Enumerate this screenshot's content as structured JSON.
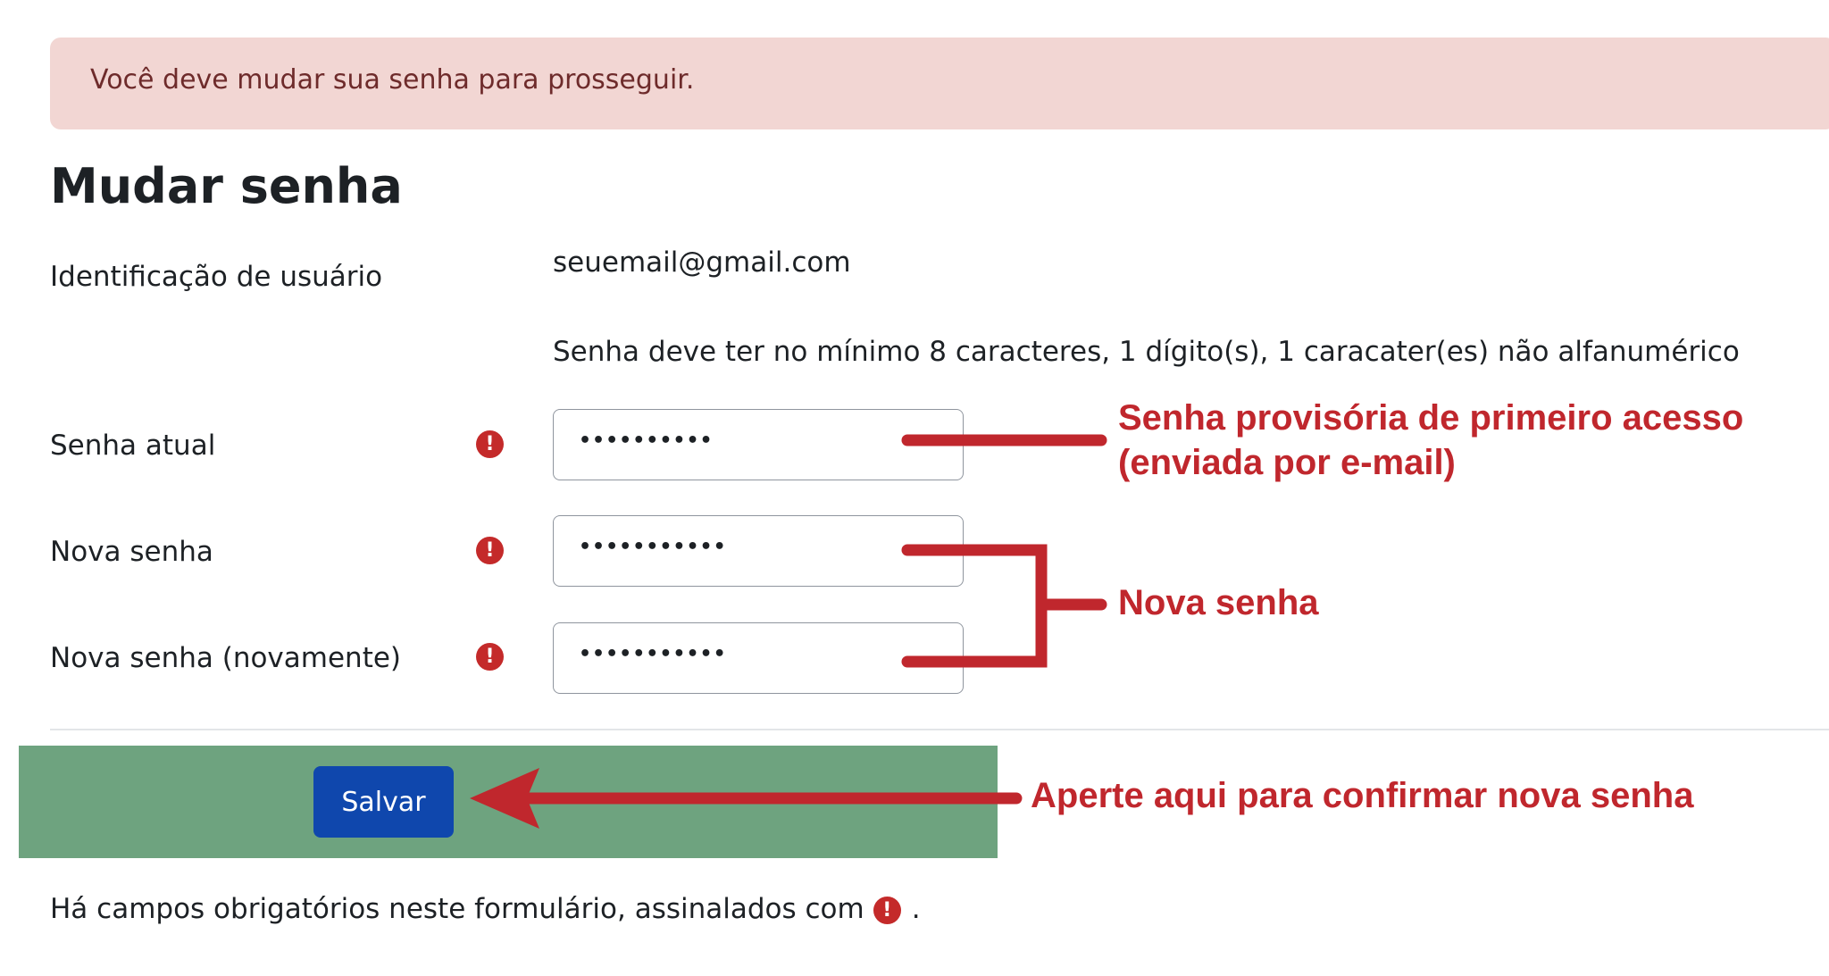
{
  "alert": {
    "text": "Você deve mudar sua senha para prosseguir."
  },
  "page": {
    "title": "Mudar senha"
  },
  "form": {
    "username_label": "Identificação de usuário",
    "username_value": "seuemail@gmail.com",
    "password_policy": "Senha deve ter no mínimo 8 caracteres, 1 dígito(s), 1 caracater(es) não alfanumérico",
    "current_password": {
      "label": "Senha atual",
      "value": "••••••••••"
    },
    "new_password": {
      "label": "Nova senha",
      "value": "•••••••••••"
    },
    "new_password_again": {
      "label": "Nova senha (novamente)",
      "value": "•••••••••••"
    },
    "save_label": "Salvar",
    "required_note": "Há campos obrigatórios neste formulário, assinalados com",
    "required_note_end": "."
  },
  "annotations": {
    "current_password_line1": "Senha provisória de primeiro acesso",
    "current_password_line2": "(enviada por e-mail)",
    "new_password": "Nova senha",
    "save": "Aperte aqui para confirmar nova senha"
  },
  "icons": {
    "required": "exclamation-circle-icon"
  },
  "colors": {
    "alert_bg": "#f2d6d3",
    "required_icon": "#c42a2a",
    "save_button": "#0f47ad",
    "highlight_box": "#6ea37f",
    "annotation": "#c0272d"
  }
}
